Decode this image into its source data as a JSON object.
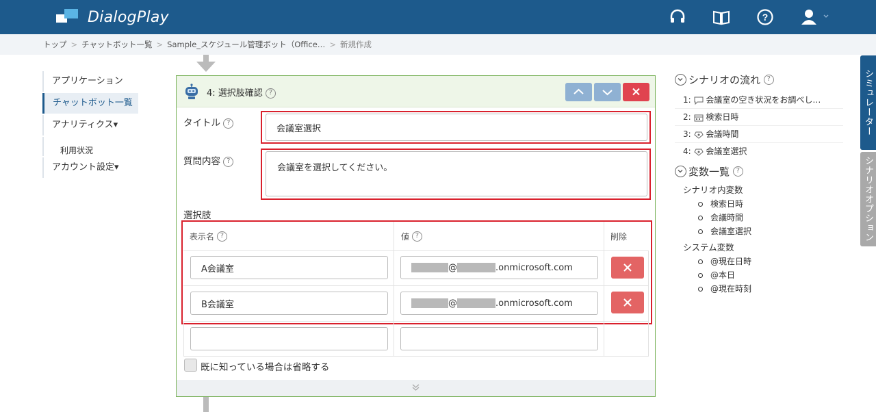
{
  "header": {
    "app_name": "DialogPlay"
  },
  "breadcrumb": [
    "トップ",
    "チャットボット一覧",
    "Sample_スケジュール管理ボット（Office…",
    "新規作成"
  ],
  "leftnav": {
    "items": [
      "アプリケーション",
      "チャットボット一覧",
      "アナリティクス▾",
      "利用状況",
      "アカウント設定▾"
    ]
  },
  "card": {
    "step_title": "4: 選択肢確認",
    "title_label": "タイトル",
    "title_value": "会議室選択",
    "question_label": "質問内容",
    "question_value": "会議室を選択してください。",
    "options_label": "選択肢",
    "col_display": "表示名",
    "col_value": "値",
    "col_delete": "削除",
    "rows": [
      {
        "display": "A会議室",
        "value_at": "@",
        "value_domain": ".onmicrosoft.com"
      },
      {
        "display": "B会議室",
        "value_at": "@",
        "value_domain": ".onmicrosoft.com"
      }
    ],
    "skip_label": "既に知っている場合は省略する"
  },
  "flow": {
    "title": "シナリオの流れ",
    "items": [
      {
        "num": "1:",
        "icon": "speech-bubble-icon",
        "label": "会議室の空き状況をお調べし…"
      },
      {
        "num": "2:",
        "icon": "calendar-icon",
        "label": "検索日時"
      },
      {
        "num": "3:",
        "icon": "list-icon",
        "label": "会議時間"
      },
      {
        "num": "4:",
        "icon": "list-icon",
        "label": "会議室選択"
      }
    ]
  },
  "variables": {
    "title": "変数一覧",
    "scenario_group": "シナリオ内変数",
    "scenario_vars": [
      "検索日時",
      "会議時間",
      "会議室選択"
    ],
    "system_group": "システム変数",
    "system_vars": [
      "@現在日時",
      "@本日",
      "@現在時刻"
    ]
  },
  "side_tabs": {
    "simulator": "シミュレーター",
    "options": "シナリオオプション"
  },
  "colors": {
    "header": "#1d5a8c",
    "accent": "#d9202c",
    "card_border": "#7ab25a"
  }
}
